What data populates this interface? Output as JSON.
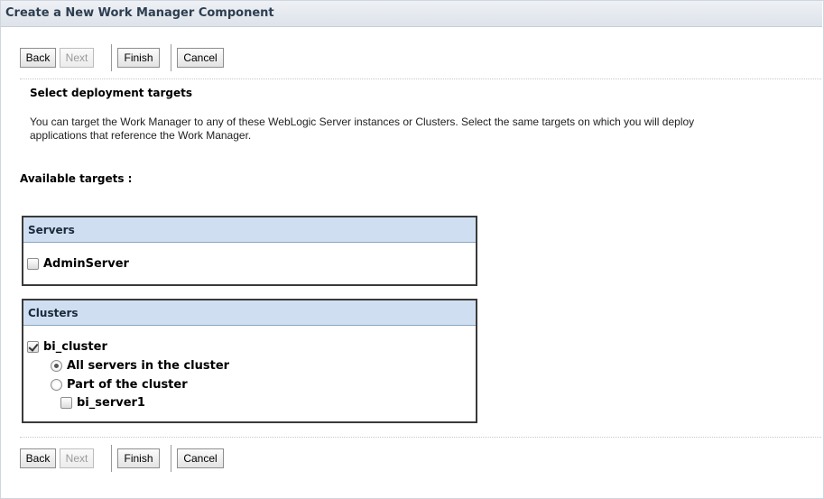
{
  "page": {
    "title": "Create a New Work Manager Component",
    "heading": "Select deployment targets",
    "description_line1": "You can target the Work Manager to any of these WebLogic Server instances or Clusters. Select the same targets on which you will deploy",
    "description_line2": "applications that reference the Work Manager.",
    "available_label": "Available targets :"
  },
  "buttons": {
    "back": "Back",
    "next": "Next",
    "finish": "Finish",
    "cancel": "Cancel"
  },
  "servers": {
    "header": "Servers",
    "items": [
      {
        "label": "AdminServer",
        "checked": false
      }
    ]
  },
  "clusters": {
    "header": "Clusters",
    "cluster": {
      "label": "bi_cluster",
      "checked": true
    },
    "options": [
      {
        "label": "All servers in the cluster",
        "selected": true
      },
      {
        "label": "Part of the cluster",
        "selected": false
      }
    ],
    "members": [
      {
        "label": "bi_server1",
        "checked": false
      }
    ]
  },
  "colors": {
    "header_bg": "#cfdff1",
    "title_text": "#2d3e50"
  }
}
